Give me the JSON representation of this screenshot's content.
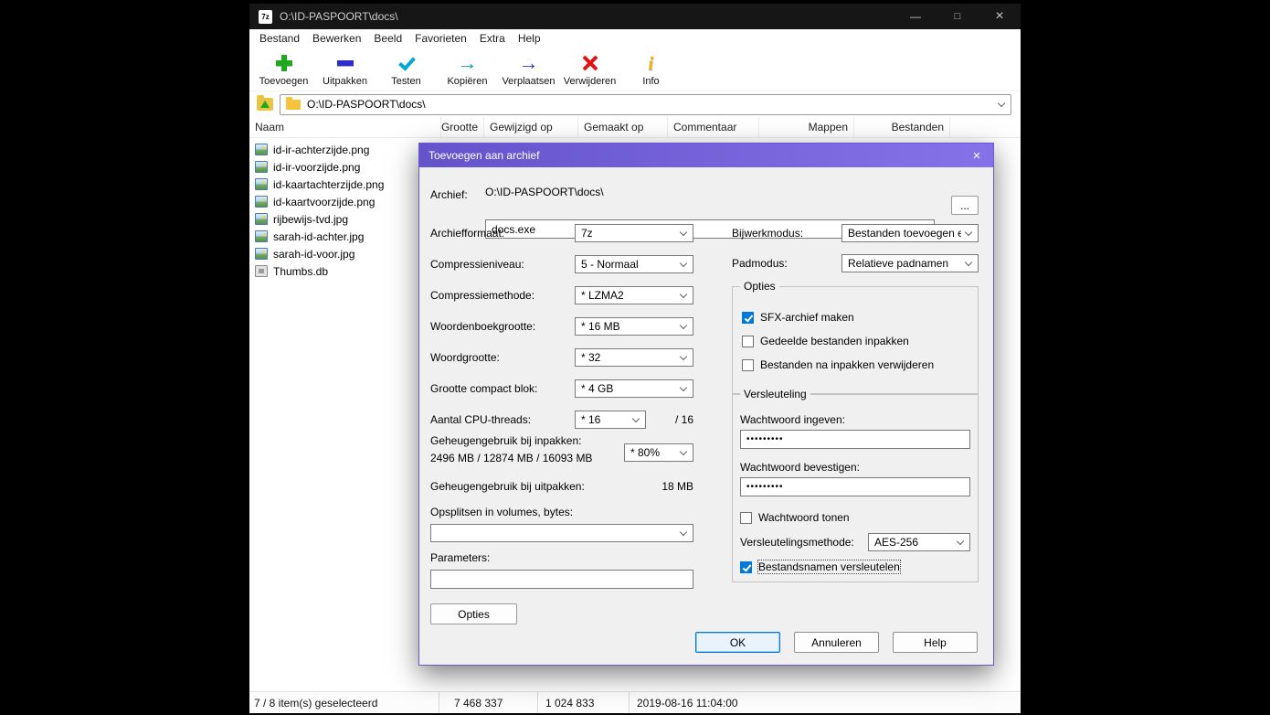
{
  "icons": {
    "minimize": "—",
    "maximize": "□",
    "close": "×"
  },
  "window": {
    "app_icon": "7z",
    "title": "O:\\ID-PASPOORT\\docs\\",
    "menu": [
      "Bestand",
      "Bewerken",
      "Beeld",
      "Favorieten",
      "Extra",
      "Help"
    ],
    "toolbar": [
      {
        "label": "Toevoegen"
      },
      {
        "label": "Uitpakken"
      },
      {
        "label": "Testen"
      },
      {
        "label": "Kopiëren",
        "glyph": "→"
      },
      {
        "label": "Verplaatsen",
        "glyph": "→"
      },
      {
        "label": "Verwijderen"
      },
      {
        "label": "Info",
        "glyph": "i"
      }
    ],
    "address": "O:\\ID-PASPOORT\\docs\\",
    "columns": {
      "naam": "Naam",
      "grootte": "Grootte",
      "gewijzigd": "Gewijzigd op",
      "gemaakt": "Gemaakt op",
      "commentaar": "Commentaar",
      "mappen": "Mappen",
      "bestanden": "Bestanden"
    },
    "files": [
      {
        "name": "id-ir-achterzijde.png"
      },
      {
        "name": "id-ir-voorzijde.png"
      },
      {
        "name": "id-kaartachterzijde.png"
      },
      {
        "name": "id-kaartvoorzijde.png"
      },
      {
        "name": "rijbewijs-tvd.jpg"
      },
      {
        "name": "sarah-id-achter.jpg"
      },
      {
        "name": "sarah-id-voor.jpg"
      },
      {
        "name": "Thumbs.db"
      }
    ],
    "status": {
      "selection": "7 / 8 item(s) geselecteerd",
      "size_total": "7 468 337",
      "size_selected": "1 024 833",
      "timestamp": "2019-08-16 11:04:00"
    }
  },
  "dialog": {
    "title": "Toevoegen aan archief",
    "archive": {
      "label": "Archief:",
      "path": "O:\\ID-PASPOORT\\docs\\",
      "name": "docs.exe",
      "browse": "..."
    },
    "left": {
      "rows": [
        {
          "label": "Archiefformaat:",
          "value": "7z"
        },
        {
          "label": "Compressieniveau:",
          "value": "5 - Normaal"
        },
        {
          "label": "Compressiemethode:",
          "value": "* LZMA2"
        },
        {
          "label": "Woordenboekgrootte:",
          "value": "* 16 MB"
        },
        {
          "label": "Woordgrootte:",
          "value": "* 32"
        },
        {
          "label": "Grootte compact blok:",
          "value": "* 4 GB"
        },
        {
          "label": "Aantal CPU-threads:",
          "value": "* 16",
          "suffix": "/ 16"
        }
      ],
      "memory_pack": {
        "label": "Geheugengebruik bij inpakken:",
        "values": "2496 MB / 12874 MB / 16093 MB",
        "value": "* 80%"
      },
      "memory_unpack": {
        "label": "Geheugengebruik bij uitpakken:",
        "value": "18 MB"
      },
      "volumes": {
        "label": "Opsplitsen in volumes, bytes:",
        "value": ""
      },
      "parameters": {
        "label": "Parameters:",
        "value": ""
      },
      "options_button": "Opties"
    },
    "right": {
      "update_mode": {
        "label": "Bijwerkmodus:",
        "value": "Bestanden toevoegen en vervangen"
      },
      "path_mode": {
        "label": "Padmodus:",
        "value": "Relatieve padnamen"
      },
      "options_group": {
        "legend": "Opties",
        "checkboxes": [
          {
            "label": "SFX-archief maken",
            "checked": true
          },
          {
            "label": "Gedeelde bestanden inpakken",
            "checked": false
          },
          {
            "label": "Bestanden na inpakken verwijderen",
            "checked": false
          }
        ]
      },
      "encryption_group": {
        "legend": "Versleuteling",
        "password_enter": {
          "label": "Wachtwoord ingeven:",
          "value": "•••••••••"
        },
        "password_confirm": {
          "label": "Wachtwoord bevestigen:",
          "value": "•••••••••"
        },
        "show_password": {
          "label": "Wachtwoord tonen",
          "checked": false
        },
        "method": {
          "label": "Versleutelingsmethode:",
          "value": "AES-256"
        },
        "encrypt_names": {
          "label": "Bestandsnamen versleutelen",
          "checked": true
        }
      }
    },
    "buttons": {
      "ok": "OK",
      "cancel": "Annuleren",
      "help": "Help"
    },
    "accent": "#0078d7",
    "titlebar_color": "#6f5fd8"
  }
}
